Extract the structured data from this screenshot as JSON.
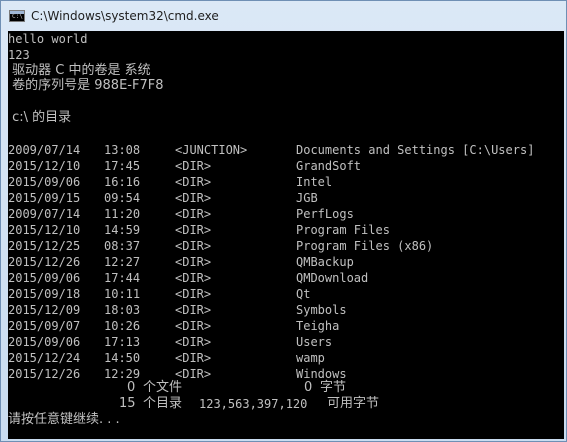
{
  "window": {
    "title": "C:\\Windows\\system32\\cmd.exe",
    "icon": "cmd-icon"
  },
  "console": {
    "line_hello": "hello world",
    "line_123": "123",
    "volume_line": " 驱动器 C 中的卷是 系统",
    "serial_line": " 卷的序列号是 988E-F7F8",
    "dir_header": " c:\\ 的目录",
    "entries": [
      {
        "date": "2009/07/14",
        "time": "13:08",
        "type": "<JUNCTION>",
        "name": "Documents and Settings [C:\\Users]"
      },
      {
        "date": "2015/12/10",
        "time": "17:45",
        "type": "<DIR>",
        "name": "GrandSoft"
      },
      {
        "date": "2015/09/06",
        "time": "16:16",
        "type": "<DIR>",
        "name": "Intel"
      },
      {
        "date": "2015/09/15",
        "time": "09:54",
        "type": "<DIR>",
        "name": "JGB"
      },
      {
        "date": "2009/07/14",
        "time": "11:20",
        "type": "<DIR>",
        "name": "PerfLogs"
      },
      {
        "date": "2015/12/10",
        "time": "14:59",
        "type": "<DIR>",
        "name": "Program Files"
      },
      {
        "date": "2015/12/25",
        "time": "08:37",
        "type": "<DIR>",
        "name": "Program Files (x86)"
      },
      {
        "date": "2015/12/26",
        "time": "12:27",
        "type": "<DIR>",
        "name": "QMBackup"
      },
      {
        "date": "2015/09/06",
        "time": "17:44",
        "type": "<DIR>",
        "name": "QMDownload"
      },
      {
        "date": "2015/09/18",
        "time": "10:11",
        "type": "<DIR>",
        "name": "Qt"
      },
      {
        "date": "2015/12/09",
        "time": "18:03",
        "type": "<DIR>",
        "name": "Symbols"
      },
      {
        "date": "2015/09/07",
        "time": "10:26",
        "type": "<DIR>",
        "name": "Teigha"
      },
      {
        "date": "2015/09/06",
        "time": "17:13",
        "type": "<DIR>",
        "name": "Users"
      },
      {
        "date": "2015/12/24",
        "time": "14:50",
        "type": "<DIR>",
        "name": "wamp"
      },
      {
        "date": "2015/12/26",
        "time": "12:29",
        "type": "<DIR>",
        "name": "Windows"
      }
    ],
    "files_count": "0",
    "files_label": "个文件",
    "files_bytes": "0",
    "bytes_label": "字节",
    "dirs_count": "15",
    "dirs_label": "个目录",
    "free_bytes": "123,563,397,120",
    "free_label": "可用字节",
    "prompt": "请按任意键继续. . ."
  }
}
